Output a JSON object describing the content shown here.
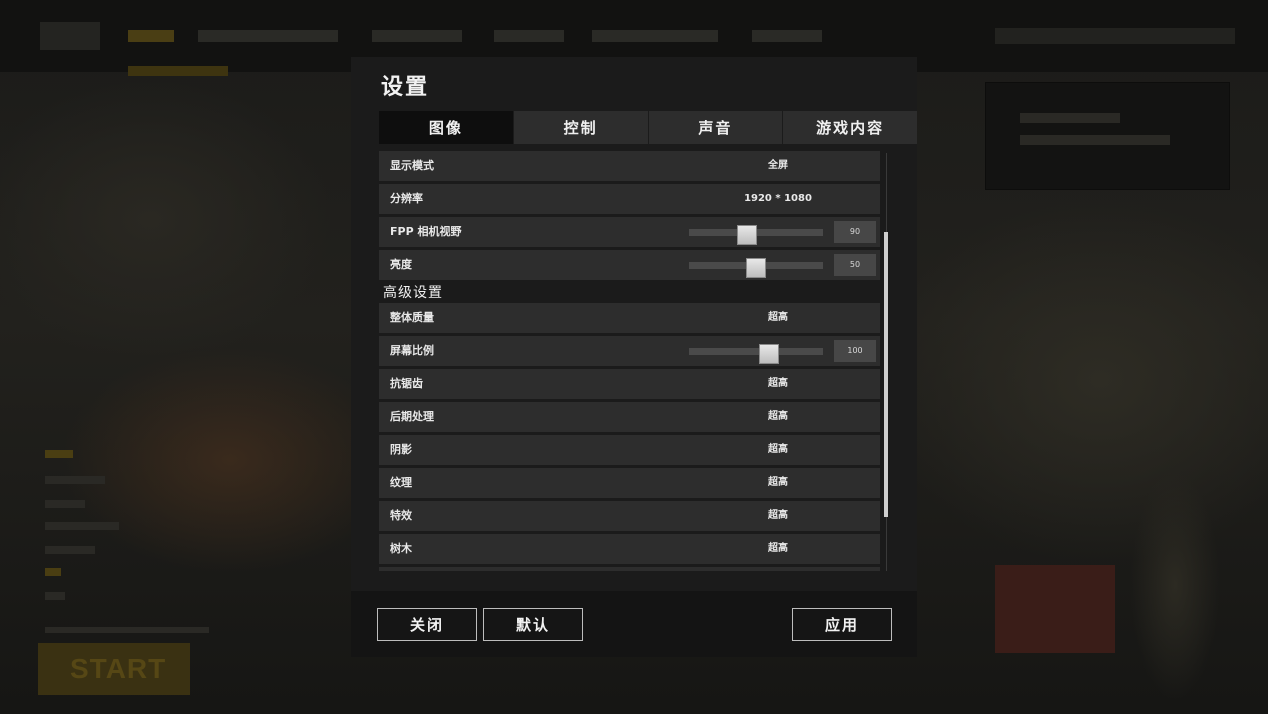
{
  "dialog": {
    "title": "设置",
    "tabs": [
      {
        "label": "图像",
        "active": true
      },
      {
        "label": "控制",
        "active": false
      },
      {
        "label": "声音",
        "active": false
      },
      {
        "label": "游戏内容",
        "active": false
      }
    ]
  },
  "graphics": {
    "display_mode": {
      "label": "显示模式",
      "value": "全屏"
    },
    "resolution": {
      "label": "分辨率",
      "value": "1920 * 1080"
    },
    "fpp_fov": {
      "label": "FPP 相机视野",
      "value": "90",
      "fraction": 0.43
    },
    "brightness": {
      "label": "亮度",
      "value": "50",
      "fraction": 0.5
    },
    "advanced_heading": "高级设置",
    "overall_quality": {
      "label": "整体质量",
      "value": "超高"
    },
    "screen_scale": {
      "label": "屏幕比例",
      "value": "100",
      "fraction": 0.6
    },
    "anti_aliasing": {
      "label": "抗锯齿",
      "value": "超高"
    },
    "post_processing": {
      "label": "后期处理",
      "value": "超高"
    },
    "shadows": {
      "label": "阴影",
      "value": "超高"
    },
    "textures": {
      "label": "纹理",
      "value": "超高"
    },
    "effects": {
      "label": "特效",
      "value": "超高"
    },
    "foliage": {
      "label": "树木",
      "value": "超高"
    }
  },
  "footer": {
    "close_label": "关闭",
    "default_label": "默认",
    "apply_label": "应用"
  },
  "background": {
    "start_label": "START"
  },
  "colors": {
    "panel": "#1b1b1b",
    "row": "#2d2d2d",
    "active_tab": "#0e0e0e",
    "slider_track": "#4a4a4a"
  }
}
